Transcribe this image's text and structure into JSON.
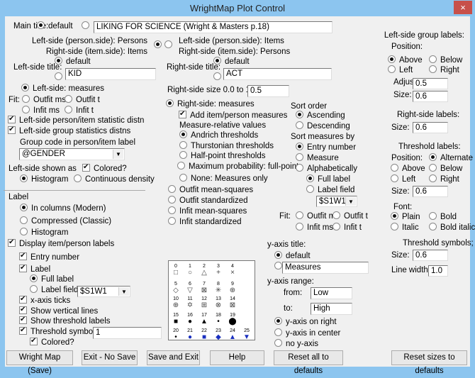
{
  "window": {
    "title": "WrightMap Plot Control",
    "close": "×"
  },
  "main_title": {
    "label": "Main title:",
    "default_label": "default",
    "default_selected": true,
    "value": "LIKING FOR SCIENCE (Wright & Masters p.18)"
  },
  "orientation": {
    "opt1_line1": "Left-side (person.side): Persons",
    "opt1_line2": "Right-side (item.side): Items",
    "opt2_line1": "Left-side (person.side): Items",
    "opt2_line2": "Right-side (item.side): Persons",
    "selected": 1
  },
  "left_title": {
    "label": "Left-side title:",
    "default_label": "default",
    "value": "KID"
  },
  "right_title": {
    "label": "Right-side title:",
    "default_label": "default",
    "value": "ACT"
  },
  "right_size": {
    "label": "Right-side size 0.0 to 1.0:",
    "value": "0.5"
  },
  "left_side": {
    "measures": "Left-side: measures",
    "fit": "Fit:",
    "outfit_ms": "Outfit ms",
    "outfit_t": "Outfit t",
    "infit_ms": "Infit ms",
    "infit_t": "Infit t",
    "stat_distn": "Left-side person/item statistic distn",
    "group_distns": "Left-side group statistics distns",
    "group_code_label": "Group code in person/item label",
    "group_code": "@GENDER",
    "shown_as": "Left-side shown as",
    "colored": "Colored?",
    "histogram": "Histogram",
    "density": "Continuous density"
  },
  "right_shown": {
    "label": "Label",
    "columns": "In columns (Modern)",
    "compressed": "Compressed (Classic)",
    "histogram": "Histogram",
    "display_labels": "Display item/person labels",
    "entry_number": "Entry number",
    "full_label": "Full label",
    "label_field": "Label field",
    "label_field_value": "$S1W1",
    "x_ticks": "x-axis ticks",
    "vertical_lines": "Show vertical lines",
    "threshold_labels": "Show threshold labels",
    "threshold_symbols": "Threshold symbols:",
    "threshold_symbols_value": "1",
    "colored": "Colored?"
  },
  "right_measures": {
    "measures": "Right-side: measures",
    "add": "Add item/person measures",
    "relative": "Measure-relative values",
    "andrich": "Andrich thresholds",
    "thurstonian": "Thurstonian thresholds",
    "halfpoint": "Half-point thresholds",
    "maxprob": "Maximum probability: full-point",
    "none": "None: Measures only",
    "outfit_msq": "Outfit mean-squares",
    "outfit_std": "Outfit standardized",
    "infit_msq": "Infit mean-squares",
    "infit_std": "Infit standardized"
  },
  "sort": {
    "order": "Sort order",
    "ascending": "Ascending",
    "descending": "Descending",
    "by": "Sort measures by",
    "entry": "Entry number",
    "measure": "Measure",
    "alpha": "Alphabetically",
    "full_label": "Full label",
    "label_field": "Label field",
    "field_value": "$S1W1",
    "fit": "Fit:",
    "outfit_ms": "Outfit ms",
    "outfit_t": "Outfit t",
    "infit_ms": "Infit ms",
    "infit_t": "Infit t"
  },
  "yaxis": {
    "title_label": "y-axis title:",
    "default": "default",
    "title_value": "Measures",
    "range": "y-axis range:",
    "from": "from:",
    "from_value": "Low",
    "to": "to:",
    "to_value": "High",
    "on_right": "y-axis on right",
    "center": "y-axis in center",
    "none": "no y-axis"
  },
  "group_labels": {
    "title": "Left-side group labels:",
    "position": "Position:",
    "above": "Above",
    "below": "Below",
    "left": "Left",
    "right": "Right",
    "adjust": "Adjust:",
    "adjust_value": "0.5",
    "size": "Size:",
    "size_value": "0.6"
  },
  "right_labels": {
    "title": "Right-side labels:",
    "size": "Size:",
    "size_value": "0.6"
  },
  "threshold_labels": {
    "title": "Threshold labels:",
    "position": "Position:",
    "alternate": "Alternate",
    "above": "Above",
    "below": "Below",
    "left": "Left",
    "right": "Right",
    "size": "Size:",
    "size_value": "0.6",
    "font": "Font:",
    "plain": "Plain",
    "bold": "Bold",
    "italic": "Italic",
    "bold_italic": "Bold italic"
  },
  "threshold_symbols": {
    "title": "Threshold symbols;",
    "size": "Size:",
    "size_value": "0.6",
    "line_width": "Line width:",
    "line_width_value": "1.0"
  },
  "symbols": [
    {
      "n": "0",
      "g": "□",
      "c": "#444"
    },
    {
      "n": "1",
      "g": "○",
      "c": "#444"
    },
    {
      "n": "2",
      "g": "△",
      "c": "#444"
    },
    {
      "n": "3",
      "g": "+",
      "c": "#444"
    },
    {
      "n": "4",
      "g": "×",
      "c": "#444"
    },
    {
      "n": "5",
      "g": "◇",
      "c": "#444"
    },
    {
      "n": "6",
      "g": "▽",
      "c": "#444"
    },
    {
      "n": "7",
      "g": "⊠",
      "c": "#444"
    },
    {
      "n": "8",
      "g": "✳",
      "c": "#444"
    },
    {
      "n": "9",
      "g": "⊕",
      "c": "#444"
    },
    {
      "n": "10",
      "g": "⊕",
      "c": "#444"
    },
    {
      "n": "11",
      "g": "✡",
      "c": "#444"
    },
    {
      "n": "12",
      "g": "⊞",
      "c": "#444"
    },
    {
      "n": "13",
      "g": "⊗",
      "c": "#444"
    },
    {
      "n": "14",
      "g": "⊠",
      "c": "#444"
    },
    {
      "n": "15",
      "g": "■",
      "c": "#000"
    },
    {
      "n": "16",
      "g": "●",
      "c": "#000"
    },
    {
      "n": "17",
      "g": "▲",
      "c": "#000"
    },
    {
      "n": "18",
      "g": "•",
      "c": "#000"
    },
    {
      "n": "19",
      "g": "⬤",
      "c": "#000"
    },
    {
      "n": "20",
      "g": "•",
      "c": "#000"
    },
    {
      "n": "21",
      "g": "●",
      "c": "#1a2fbf"
    },
    {
      "n": "22",
      "g": "■",
      "c": "#1a2fbf"
    },
    {
      "n": "23",
      "g": "◆",
      "c": "#1a2fbf"
    },
    {
      "n": "24",
      "g": "▲",
      "c": "#1a2fbf"
    },
    {
      "n": "25",
      "g": "▼",
      "c": "#1a2fbf"
    }
  ],
  "buttons": {
    "wright_map": "Wright Map (Save)",
    "exit": "Exit - No Save",
    "save_exit": "Save and Exit",
    "help": "Help",
    "reset_all": "Reset all to defaults",
    "reset_sizes": "Reset sizes to defaults"
  }
}
